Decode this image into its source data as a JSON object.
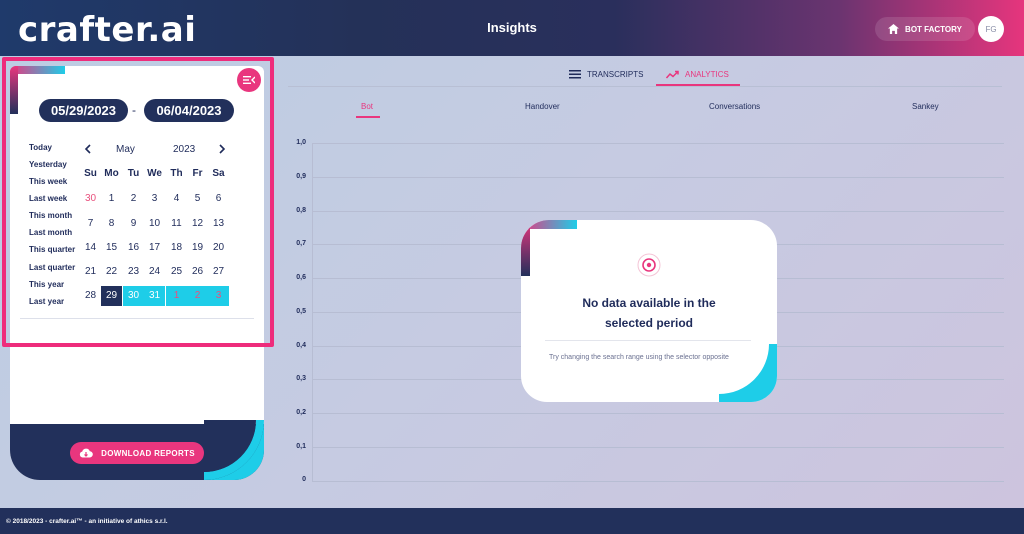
{
  "header": {
    "logo": "crafter.ai",
    "title": "Insights",
    "bot_factory_label": "BOT FACTORY",
    "avatar_initials": "FG"
  },
  "sidebar": {
    "date_from": "05/29/2023",
    "date_separator": "-",
    "date_to": "06/04/2023",
    "quick_ranges": [
      "Today",
      "Yesterday",
      "This week",
      "Last week",
      "This month",
      "Last month",
      "This quarter",
      "Last quarter",
      "This year",
      "Last year"
    ],
    "calendar": {
      "month": "May",
      "year": "2023",
      "prev_icon": "chevron-left-icon",
      "next_icon": "chevron-right-icon",
      "weekdays": [
        "Su",
        "Mo",
        "Tu",
        "We",
        "Th",
        "Fr",
        "Sa"
      ],
      "weeks": [
        [
          "30",
          "1",
          "2",
          "3",
          "4",
          "5",
          "6"
        ],
        [
          "7",
          "8",
          "9",
          "10",
          "11",
          "12",
          "13"
        ],
        [
          "14",
          "15",
          "16",
          "17",
          "18",
          "19",
          "20"
        ],
        [
          "21",
          "22",
          "23",
          "24",
          "25",
          "26",
          "27"
        ],
        [
          "28",
          "29",
          "30",
          "31",
          "1",
          "2",
          "3"
        ]
      ]
    },
    "download_label": "DOWNLOAD REPORTS"
  },
  "tabs": [
    {
      "label": "TRANSCRIPTS",
      "icon": "list-icon"
    },
    {
      "label": "ANALYTICS",
      "icon": "trend-icon",
      "active": true
    }
  ],
  "subtabs": [
    {
      "label": "Bot",
      "active": true
    },
    {
      "label": "Handover"
    },
    {
      "label": "Conversations"
    },
    {
      "label": "Sankey"
    }
  ],
  "chart": {
    "y_ticks": [
      "1,0",
      "0,9",
      "0,8",
      "0,7",
      "0,6",
      "0,5",
      "0,4",
      "0,3",
      "0,2",
      "0,1",
      "0"
    ]
  },
  "no_data": {
    "title_line1": "No data available in the",
    "title_line2": "selected period",
    "hint": "Try changing the search range using the selector opposite"
  },
  "footer": {
    "text": "© 2018/2023 - crafter.ai™ - an initiative of athics s.r.l."
  },
  "colors": {
    "navy": "#22305b",
    "pink": "#e9367e",
    "cyan": "#1ecde8"
  }
}
